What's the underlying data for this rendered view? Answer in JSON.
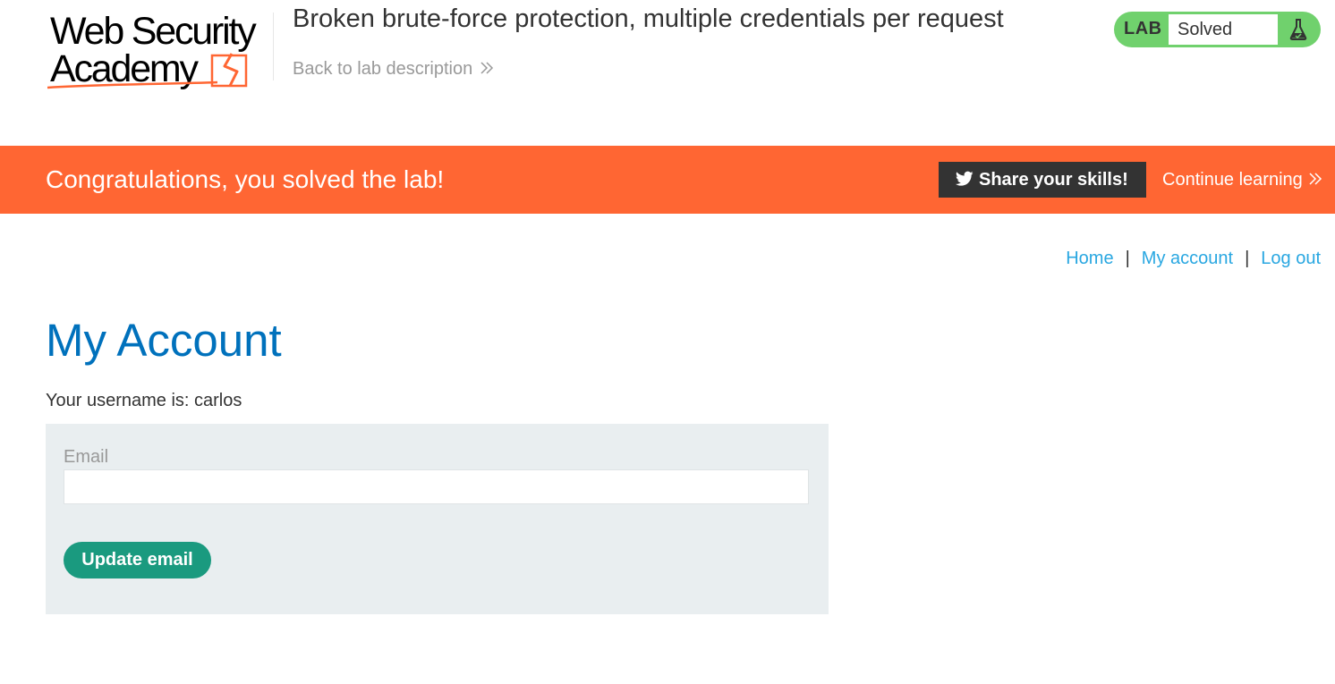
{
  "header": {
    "logo_line1": "Web Security",
    "logo_line2": "Academy",
    "lab_title": "Broken brute-force protection, multiple credentials per request",
    "back_link": "Back to lab description",
    "lab_badge": "LAB",
    "lab_state": "Solved",
    "icons": {
      "back": "double-chevron-right-icon",
      "status": "flask-icon"
    }
  },
  "banner": {
    "message": "Congratulations, you solved the lab!",
    "share_label": "Share your skills!",
    "continue_label": "Continue learning",
    "icons": {
      "share": "twitter-icon",
      "continue": "double-chevron-right-icon"
    }
  },
  "nav": {
    "items": [
      {
        "label": "Home"
      },
      {
        "label": "My account"
      },
      {
        "label": "Log out"
      }
    ],
    "separator": "|"
  },
  "main": {
    "title": "My Account",
    "username_line": "Your username is: carlos",
    "email_label": "Email",
    "email_value": "",
    "update_button": "Update email"
  },
  "colors": {
    "banner": "#ff6633",
    "lab_status": "#70d16d",
    "title": "#0071bc",
    "link": "#29a7e1",
    "button": "#1a9a7f",
    "panel": "#e9eef0",
    "share_button": "#333333"
  }
}
